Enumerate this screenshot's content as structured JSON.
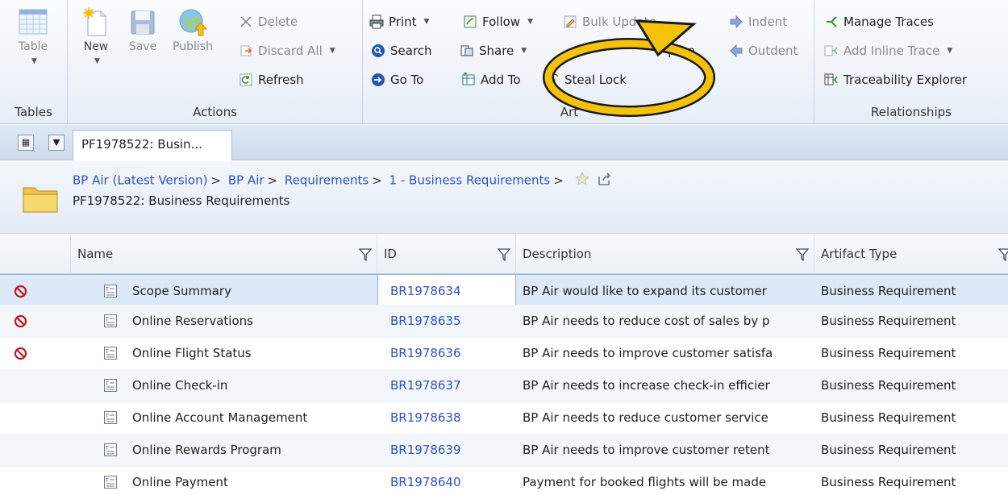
{
  "ribbon": {
    "tables": {
      "label": "Tables",
      "table_button": "Table"
    },
    "actions": {
      "label": "Actions",
      "new": "New",
      "save": "Save",
      "publish": "Publish",
      "delete": "Delete",
      "discard_all": "Discard All",
      "refresh": "Refresh"
    },
    "artifact": {
      "label": "Art",
      "print": "Print",
      "follow": "Follow",
      "bulk_update": "Bulk Update",
      "search": "Search",
      "share": "Share",
      "compare": "pare",
      "goto": "Go To",
      "add_to": "Add To",
      "steal_lock": "Steal Lock",
      "indent": "Indent",
      "outdent": "Outdent"
    },
    "relationships": {
      "label": "Relationships",
      "manage_traces": "Manage Traces",
      "add_inline_trace": "Add Inline Trace",
      "traceability_explorer": "Traceability Explorer"
    }
  },
  "tabs": {
    "active": "PF1978522: Busin..."
  },
  "breadcrumb": {
    "items": [
      "BP Air (Latest Version)",
      "BP Air",
      "Requirements",
      "1 - Business Requirements"
    ],
    "separator": ">",
    "title": "PF1978522: Business Requirements"
  },
  "grid": {
    "columns": [
      "Name",
      "ID",
      "Description",
      "Artifact Type"
    ],
    "rows": [
      {
        "name": "Scope Summary",
        "id": "BR1978634",
        "description": "BP Air would like to expand its customer",
        "type": "Business Requirement",
        "locked": true
      },
      {
        "name": "Online Reservations",
        "id": "BR1978635",
        "description": "BP Air needs to reduce cost of sales by p",
        "type": "Business Requirement",
        "locked": true
      },
      {
        "name": "Online Flight Status",
        "id": "BR1978636",
        "description": "BP Air needs to improve customer satisfa",
        "type": "Business Requirement",
        "locked": true
      },
      {
        "name": "Online Check-in",
        "id": "BR1978637",
        "description": "BP Air needs to increase check-in efficier",
        "type": "Business Requirement",
        "locked": false
      },
      {
        "name": "Online Account Management",
        "id": "BR1978638",
        "description": "BP Air needs to reduce customer service",
        "type": "Business Requirement",
        "locked": false
      },
      {
        "name": "Online Rewards Program",
        "id": "BR1978639",
        "description": "BP Air needs to improve customer retent",
        "type": "Business Requirement",
        "locked": false
      },
      {
        "name": "Online Payment",
        "id": "BR1978640",
        "description": "Payment for booked flights will be made",
        "type": "Business Requirement",
        "locked": false
      }
    ]
  },
  "colors": {
    "link": "#2a52c8",
    "accent": "#f5c20b",
    "lock": "#c0141c"
  }
}
